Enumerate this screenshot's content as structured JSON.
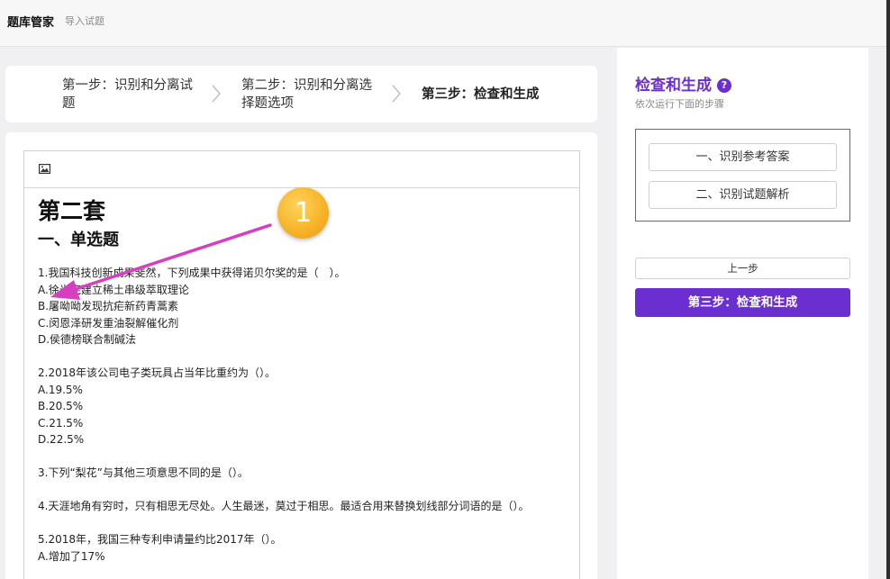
{
  "header": {
    "app_title": "题库管家",
    "import_link": "导入试题"
  },
  "steps": [
    {
      "label": "第一步：识别和分离试题",
      "state": "done"
    },
    {
      "label": "第二步：识别和分离选择题选项",
      "state": "done"
    },
    {
      "label": "第三步：检查和生成",
      "state": "current"
    }
  ],
  "editor": {
    "toolbar": {
      "image_icon": "image-icon"
    },
    "heading1": "第二套",
    "heading2": "一、单选题",
    "questions": [
      {
        "stem": "1.我国科技创新成果斐然，下列成果中获得诺贝尔奖的是（　）。",
        "options": [
          "A.徐光宪建立稀土串级萃取理论",
          "B.屠呦呦发现抗疟新药青蒿素",
          "C.闵恩泽研发重油裂解催化剂",
          "D.侯德榜联合制碱法"
        ]
      },
      {
        "stem": "2.2018年该公司电子类玩具占当年比重约为（）。",
        "options": [
          "A.19.5%",
          "B.20.5%",
          "C.21.5%",
          "D.22.5%"
        ]
      },
      {
        "stem": "3.下列“梨花”与其他三项意思不同的是（）。"
      },
      {
        "stem": "4.天涯地角有穷时，只有相思无尽处。人生最迷，莫过于相思。最适合用来替换划线部分词语的是（）。"
      },
      {
        "stem": "5.2018年，我国三种专利申请量约比2017年（）。",
        "options": [
          "A.增加了17%"
        ]
      }
    ]
  },
  "right_panel": {
    "title": "检查和生成",
    "help_icon": "?",
    "subtitle": "依次运行下面的步骤",
    "actions": [
      "一、识别参考答案",
      "二、识别试题解析"
    ],
    "prev_button": "上一步",
    "primary_button": "第三步：检查和生成"
  },
  "annotation": {
    "badge_number": "1",
    "color": "#d63fc0"
  },
  "colors": {
    "accent": "#6b2fd1",
    "badge": "#f7b42b"
  }
}
